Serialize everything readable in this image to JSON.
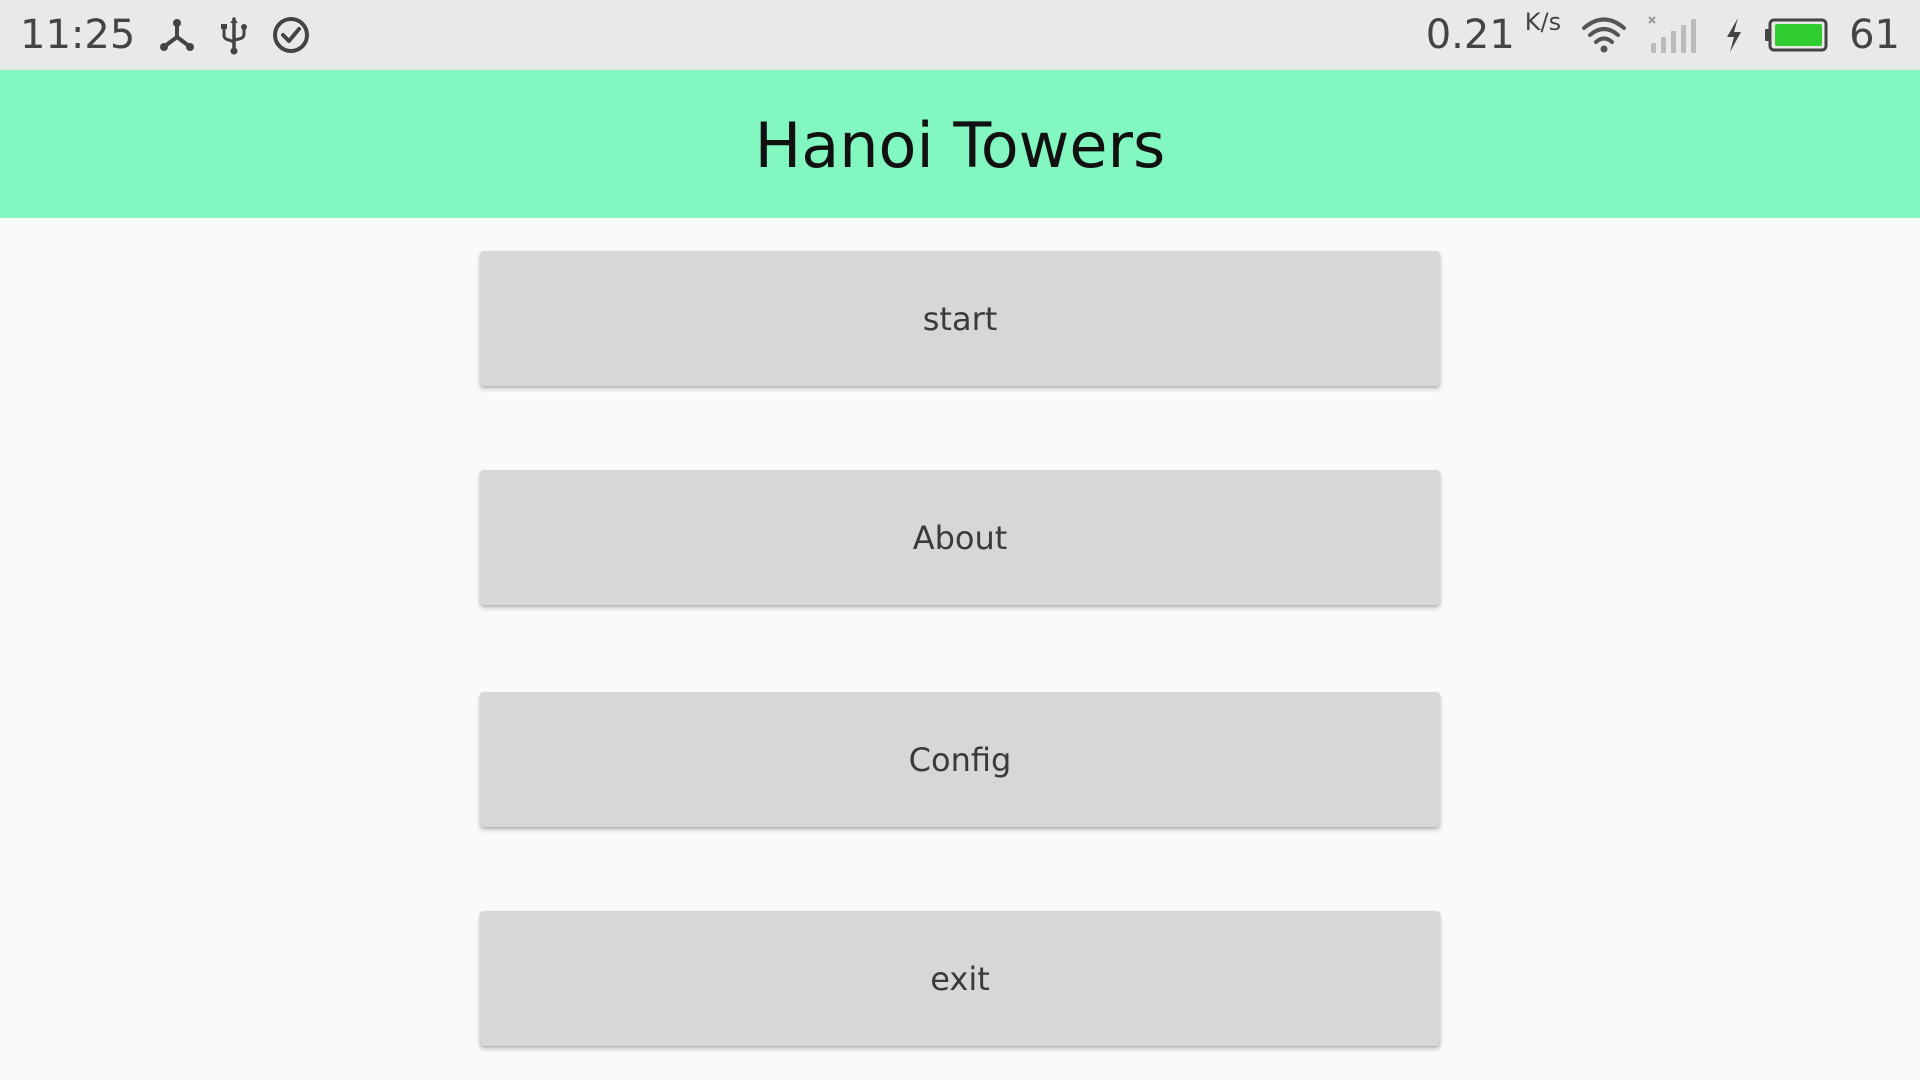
{
  "status_bar": {
    "time": "11:25",
    "net_speed_value": "0.21",
    "net_speed_unit": "K/s",
    "battery_percent": "61",
    "battery_level": 0.61,
    "battery_color": "#2ecc2e",
    "icons": [
      "share-icon",
      "usb-icon",
      "check-circle-icon",
      "wifi-icon",
      "cell-signal-icon",
      "charging-bolt-icon",
      "battery-icon"
    ]
  },
  "app_bar": {
    "title": "Hanoi Towers",
    "color": "#82f7c0"
  },
  "menu": {
    "start_label": "start",
    "about_label": "About",
    "config_label": "Config",
    "exit_label": "exit"
  }
}
